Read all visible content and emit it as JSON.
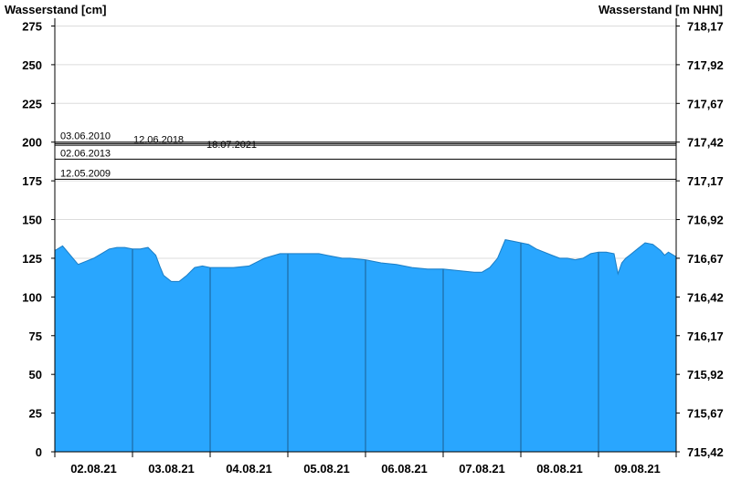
{
  "chart_data": {
    "type": "area",
    "left_axis_title": "Wasserstand [cm]",
    "right_axis_title": "Wasserstand [m NHN]",
    "ylim": [
      0,
      280
    ],
    "y_ticks": [
      0,
      25,
      50,
      75,
      100,
      125,
      150,
      175,
      200,
      225,
      250,
      275
    ],
    "right_ticks": [
      "715,42",
      "715,67",
      "715,92",
      "716,17",
      "716,42",
      "716,67",
      "716,92",
      "717,17",
      "717,42",
      "717,67",
      "717,92",
      "718,17"
    ],
    "x_range": [
      0,
      8
    ],
    "x_tick_labels": [
      "02.08.21",
      "03.08.21",
      "04.08.21",
      "05.08.21",
      "06.08.21",
      "07.08.21",
      "08.08.21",
      "09.08.21"
    ],
    "grid": true,
    "fill_color": "#29a6fe",
    "historic_levels": [
      {
        "label": "03.06.2010",
        "value": 200
      },
      {
        "label": "12.06.2018",
        "value": 199
      },
      {
        "label": "18.07.2021",
        "value": 198
      },
      {
        "label": "02.06.2013",
        "value": 189
      },
      {
        "label": "12.05.2009",
        "value": 176
      }
    ],
    "series": [
      {
        "x": [
          0,
          0.1,
          0.2,
          0.3,
          0.4,
          0.5,
          0.6,
          0.7,
          0.8,
          0.9,
          1.0,
          1.1,
          1.2,
          1.3,
          1.35,
          1.4,
          1.5,
          1.6,
          1.7,
          1.8,
          1.9,
          2.0,
          2.1,
          2.2,
          2.3,
          2.5,
          2.7,
          2.9,
          3.0,
          3.2,
          3.4,
          3.5,
          3.6,
          3.7,
          3.8,
          4.0,
          4.2,
          4.4,
          4.6,
          4.8,
          5.0,
          5.2,
          5.4,
          5.5,
          5.6,
          5.7,
          5.8,
          5.9,
          6.0,
          6.1,
          6.2,
          6.3,
          6.4,
          6.5,
          6.6,
          6.7,
          6.8,
          6.9,
          7.0,
          7.1,
          7.2,
          7.25,
          7.3,
          7.35,
          7.4,
          7.5,
          7.6,
          7.7,
          7.8,
          7.85,
          7.9,
          8.0
        ],
        "y": [
          130,
          133,
          127,
          121,
          123,
          125,
          128,
          131,
          132,
          132,
          131,
          131,
          132,
          127,
          120,
          114,
          110,
          110,
          114,
          119,
          120,
          119,
          119,
          119,
          119,
          120,
          125,
          128,
          128,
          128,
          128,
          127,
          126,
          125,
          125,
          124,
          122,
          121,
          119,
          118,
          118,
          117,
          116,
          116,
          119,
          125,
          137,
          136,
          135,
          134,
          131,
          129,
          127,
          125,
          125,
          124,
          125,
          128,
          129,
          129,
          128,
          115,
          122,
          125,
          127,
          131,
          135,
          134,
          130,
          127,
          129,
          126
        ]
      }
    ]
  }
}
